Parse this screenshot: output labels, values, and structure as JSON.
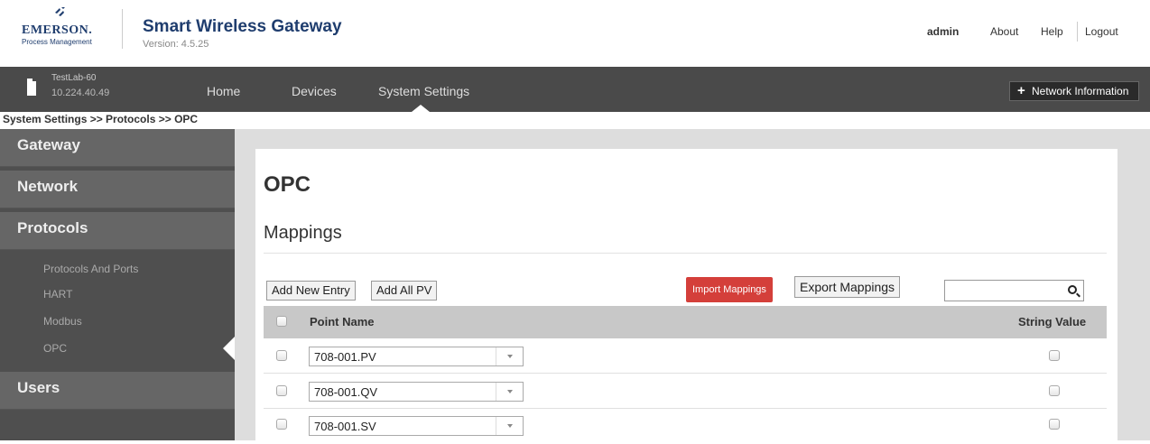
{
  "header": {
    "logo_text": "EMERSON.",
    "logo_sub": "Process Management",
    "app_title": "Smart Wireless Gateway",
    "app_version": "Version: 4.5.25",
    "user": "admin",
    "links": [
      "About",
      "Help",
      "Logout"
    ]
  },
  "navbar": {
    "gateway_name": "TestLab-60",
    "gateway_ip": "10.224.40.49",
    "items": [
      "Home",
      "Devices",
      "System Settings"
    ],
    "network_info_label": "Network Information"
  },
  "breadcrumb": "System Settings >> Protocols >> OPC",
  "sidebar": {
    "sections": [
      "Gateway",
      "Network",
      "Protocols",
      "Users"
    ],
    "protocol_items": [
      "Protocols And Ports",
      "HART",
      "Modbus",
      "OPC"
    ]
  },
  "main": {
    "page_title": "OPC",
    "section_title": "Mappings",
    "buttons": {
      "add_new_entry": "Add New Entry",
      "add_all_pv": "Add All PV",
      "import_mappings": "Import Mappings",
      "export_mappings": "Export Mappings"
    },
    "search": {
      "placeholder": ""
    },
    "table": {
      "columns": [
        "Point Name",
        "String Value"
      ],
      "rows": [
        {
          "point_name": "708-001.PV"
        },
        {
          "point_name": "708-001.QV"
        },
        {
          "point_name": "708-001.SV"
        }
      ]
    }
  },
  "colors": {
    "brand": "#1f3d6e",
    "navbar": "#4a4a4a",
    "sidebar": "#4f4f4f",
    "import_button": "#d43f3a"
  }
}
